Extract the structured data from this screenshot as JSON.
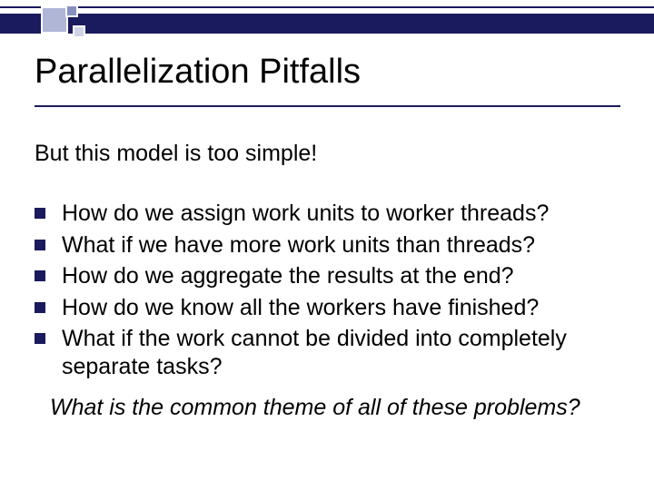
{
  "slide": {
    "title": "Parallelization Pitfalls",
    "subtitle": "But this model is too simple!",
    "bullets": [
      "How do we assign work units to worker threads?",
      "What if we have more work units than threads?",
      "How do we aggregate the results at the end?",
      "How do we know all the workers have finished?",
      "What if the work cannot be divided into completely separate tasks?"
    ],
    "footer_question": "What is the common theme of all of these problems?"
  }
}
